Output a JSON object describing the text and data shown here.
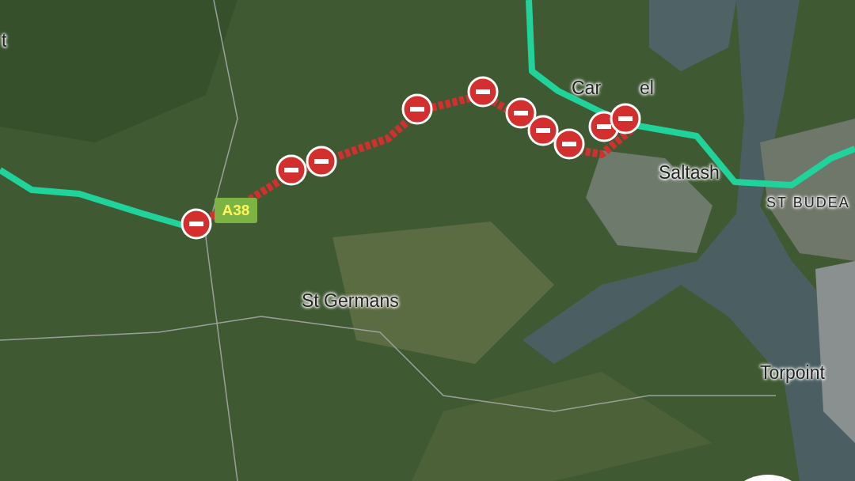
{
  "map": {
    "labels": [
      {
        "text": "t",
        "kind": "place"
      },
      {
        "text": "Car",
        "kind": "place"
      },
      {
        "text": "el",
        "kind": "place"
      },
      {
        "text": "Saltash",
        "kind": "place"
      },
      {
        "text": "ST BUDEA",
        "kind": "district"
      },
      {
        "text": "St Germans",
        "kind": "place"
      },
      {
        "text": "Torpoint",
        "kind": "place"
      }
    ],
    "road_shield": "A38"
  }
}
